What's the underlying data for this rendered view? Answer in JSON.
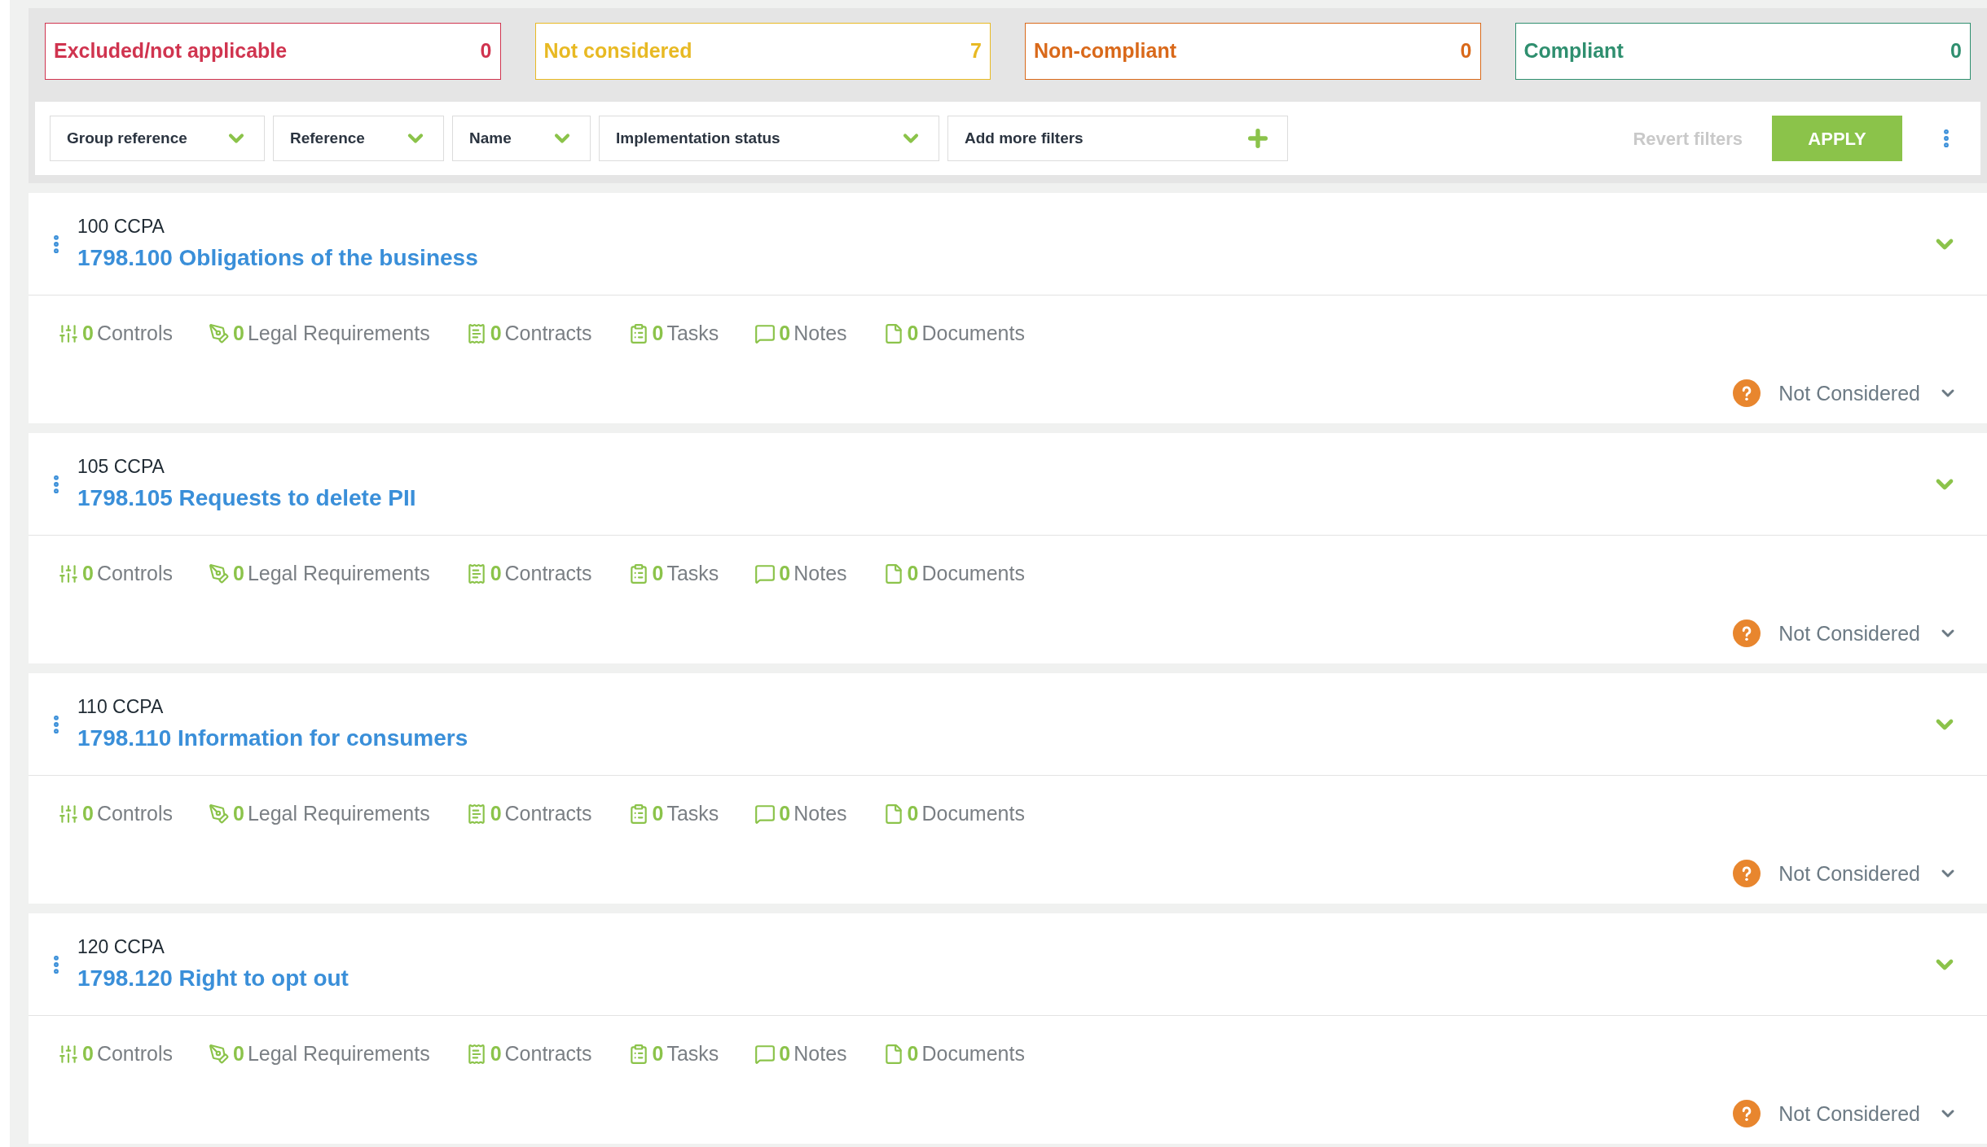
{
  "summary": [
    {
      "label": "Excluded/not applicable",
      "count": "0",
      "color": "#d0344f"
    },
    {
      "label": "Not considered",
      "count": "7",
      "color": "#e8b923"
    },
    {
      "label": "Non-compliant",
      "count": "0",
      "color": "#d9691a"
    },
    {
      "label": "Compliant",
      "count": "0",
      "color": "#2f8f6f"
    }
  ],
  "filters": [
    {
      "kind": "select",
      "label": "Group reference"
    },
    {
      "kind": "select",
      "label": "Reference"
    },
    {
      "kind": "select",
      "label": "Name"
    },
    {
      "kind": "select",
      "label": "Implementation status"
    },
    {
      "kind": "add",
      "label": "Add more filters"
    }
  ],
  "filter_actions": {
    "revert": "Revert filters",
    "apply": "APPLY"
  },
  "items": [
    {
      "group": "100 CCPA",
      "title": "1798.100 Obligations of the business",
      "stats": [
        {
          "kind": "controls",
          "count": "0",
          "label": "Controls"
        },
        {
          "kind": "legal",
          "count": "0",
          "label": "Legal Requirements"
        },
        {
          "kind": "contracts",
          "count": "0",
          "label": "Contracts"
        },
        {
          "kind": "tasks",
          "count": "0",
          "label": "Tasks"
        },
        {
          "kind": "notes",
          "count": "0",
          "label": "Notes"
        },
        {
          "kind": "documents",
          "count": "0",
          "label": "Documents"
        }
      ],
      "status": "Not Considered"
    },
    {
      "group": "105 CCPA",
      "title": "1798.105 Requests to delete PII",
      "stats": [
        {
          "kind": "controls",
          "count": "0",
          "label": "Controls"
        },
        {
          "kind": "legal",
          "count": "0",
          "label": "Legal Requirements"
        },
        {
          "kind": "contracts",
          "count": "0",
          "label": "Contracts"
        },
        {
          "kind": "tasks",
          "count": "0",
          "label": "Tasks"
        },
        {
          "kind": "notes",
          "count": "0",
          "label": "Notes"
        },
        {
          "kind": "documents",
          "count": "0",
          "label": "Documents"
        }
      ],
      "status": "Not Considered"
    },
    {
      "group": "110 CCPA",
      "title": "1798.110 Information for consumers",
      "stats": [
        {
          "kind": "controls",
          "count": "0",
          "label": "Controls"
        },
        {
          "kind": "legal",
          "count": "0",
          "label": "Legal Requirements"
        },
        {
          "kind": "contracts",
          "count": "0",
          "label": "Contracts"
        },
        {
          "kind": "tasks",
          "count": "0",
          "label": "Tasks"
        },
        {
          "kind": "notes",
          "count": "0",
          "label": "Notes"
        },
        {
          "kind": "documents",
          "count": "0",
          "label": "Documents"
        }
      ],
      "status": "Not Considered"
    },
    {
      "group": "120 CCPA",
      "title": "1798.120 Right to opt out",
      "stats": [
        {
          "kind": "controls",
          "count": "0",
          "label": "Controls"
        },
        {
          "kind": "legal",
          "count": "0",
          "label": "Legal Requirements"
        },
        {
          "kind": "contracts",
          "count": "0",
          "label": "Contracts"
        },
        {
          "kind": "tasks",
          "count": "0",
          "label": "Tasks"
        },
        {
          "kind": "notes",
          "count": "0",
          "label": "Notes"
        },
        {
          "kind": "documents",
          "count": "0",
          "label": "Documents"
        }
      ],
      "status": "Not Considered"
    }
  ]
}
